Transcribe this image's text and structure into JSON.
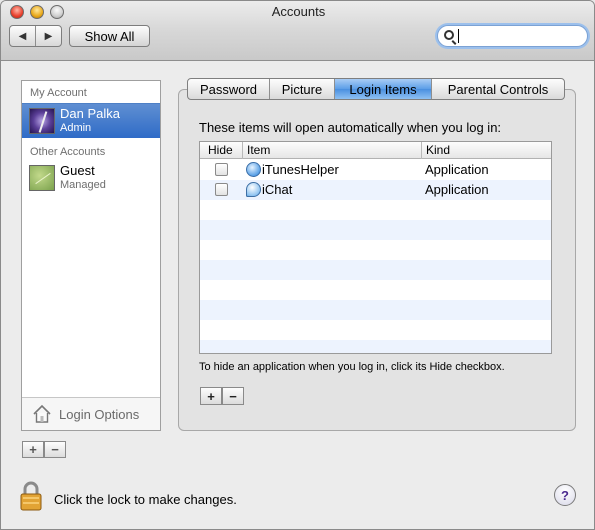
{
  "window": {
    "title": "Accounts"
  },
  "toolbar": {
    "back_glyph": "◀",
    "forward_glyph": "▶",
    "show_all_label": "Show All",
    "search_value": ""
  },
  "sidebar": {
    "my_account_label": "My Account",
    "other_accounts_label": "Other Accounts",
    "accounts": [
      {
        "name": "Dan Palka",
        "role": "Admin",
        "selected": true
      },
      {
        "name": "Guest",
        "role": "Managed",
        "selected": false
      }
    ],
    "login_options_label": "Login Options",
    "add_label": "+",
    "remove_label": "−"
  },
  "tabs": [
    {
      "label": "Password",
      "active": false
    },
    {
      "label": "Picture",
      "active": false
    },
    {
      "label": "Login Items",
      "active": true
    },
    {
      "label": "Parental Controls",
      "active": false
    }
  ],
  "login_items": {
    "description": "These items will open automatically when you log in:",
    "columns": [
      "Hide",
      "Item",
      "Kind"
    ],
    "rows": [
      {
        "hide": false,
        "item": "iTunesHelper",
        "kind": "Application",
        "icon": "itunes-icon"
      },
      {
        "hide": false,
        "item": "iChat",
        "kind": "Application",
        "icon": "ichat-icon"
      }
    ],
    "hint": "To hide an application when you log in, click its Hide checkbox.",
    "add_label": "+",
    "remove_label": "−"
  },
  "footer": {
    "lock_text": "Click the lock to make changes.",
    "help_label": "?"
  },
  "colors": {
    "selection": "#3b74cb",
    "tab_active": "#5b9ee8",
    "row_alt": "#edf3fe"
  }
}
